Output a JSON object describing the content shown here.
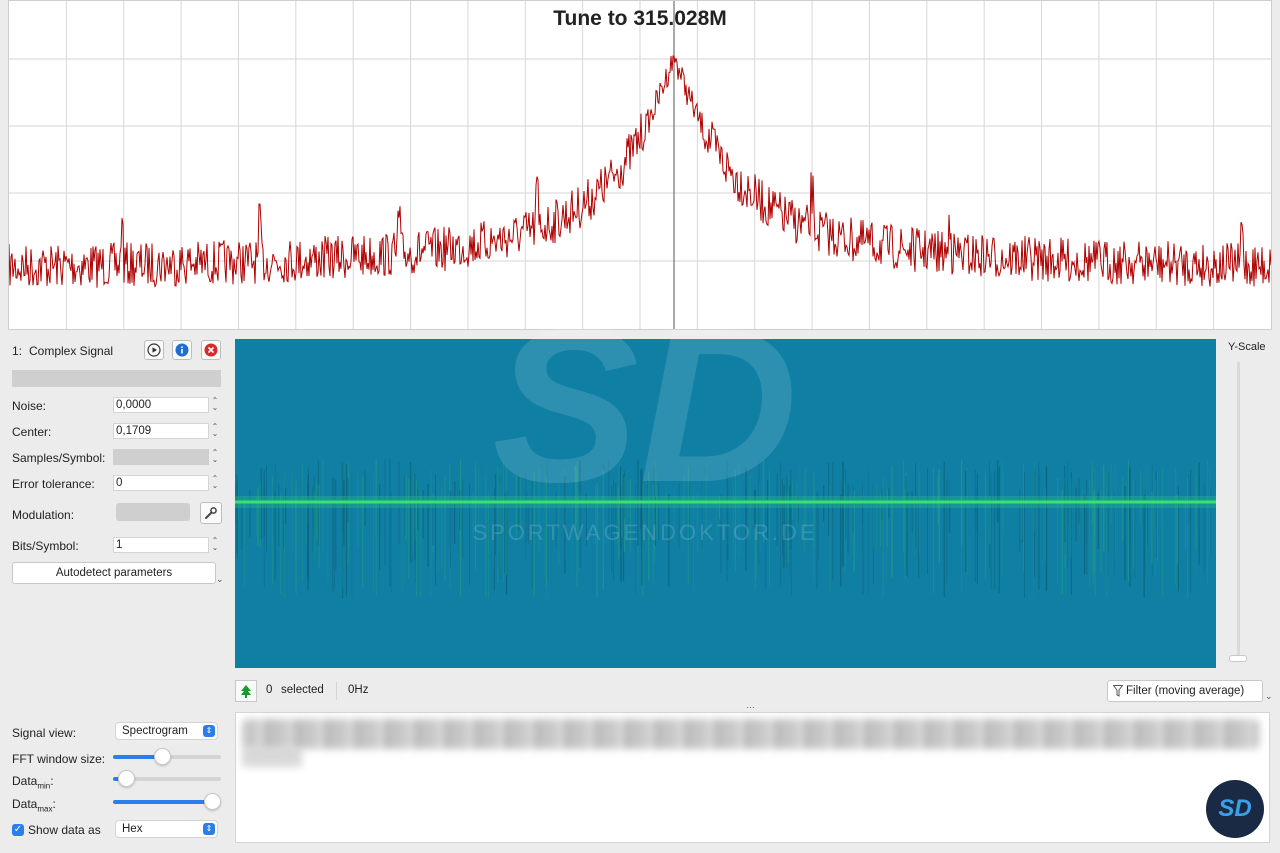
{
  "fft": {
    "title": "Tune to 315.028M",
    "trace_color": "#b00000"
  },
  "signal": {
    "index_label": "1:",
    "name": "Complex Signal",
    "fields": {
      "noise_label": "Noise:",
      "noise_value": "0,0000",
      "center_label": "Center:",
      "center_value": "0,1709",
      "samples_label": "Samples/Symbol:",
      "samples_value": "",
      "error_label": "Error tolerance:",
      "error_value": "0",
      "modulation_label": "Modulation:",
      "bits_label": "Bits/Symbol:",
      "bits_value": "1"
    },
    "autodetect_label": "Autodetect parameters"
  },
  "view": {
    "signal_view_label": "Signal view:",
    "signal_view_value": "Spectrogram",
    "fft_window_label": "FFT window size:",
    "fft_window_level": 0.45,
    "data_min_label": "Data",
    "data_min_sub": "min",
    "data_min_level": 0.12,
    "data_max_label": "Data",
    "data_max_sub": "max",
    "data_max_level": 0.92,
    "show_data_label": "Show data as",
    "show_data_checked": true,
    "show_data_value": "Hex"
  },
  "spectrogram": {
    "background": "#0f7fa4",
    "line_color": "#39e36a",
    "yscale_label": "Y-Scale"
  },
  "status": {
    "selected_count": "0",
    "selected_label": "selected",
    "frequency": "0Hz",
    "filter_label": "Filter (moving average)"
  },
  "watermark": {
    "text": "SPORTWAGENDOKTOR.DE",
    "logo_text": "SD"
  }
}
